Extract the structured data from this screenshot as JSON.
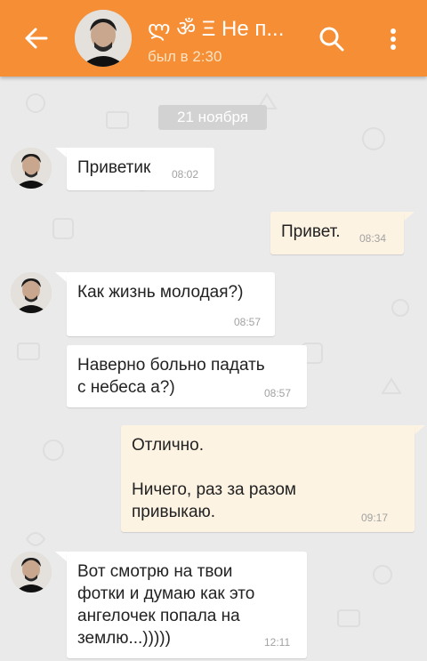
{
  "colors": {
    "header": "#f58e34",
    "incoming_bubble": "#ffffff",
    "outgoing_bubble": "#fdf3e3",
    "background": "#eaeaea"
  },
  "header": {
    "title": "ლ ॐ Ξ Не п...",
    "subtitle": "был в 2:30",
    "back_icon": "arrow-left-icon",
    "search_icon": "search-icon",
    "menu_icon": "more-vertical-icon"
  },
  "date_separator": "21 ноября",
  "messages": [
    {
      "direction": "in",
      "text": "Приветик",
      "time": "08:02"
    },
    {
      "direction": "out",
      "text": "Привет.",
      "time": "08:34"
    },
    {
      "direction": "in",
      "text": "Как жизнь молодая?)",
      "time": "08:57"
    },
    {
      "direction": "in",
      "text": "Наверно больно падать\nс небеса а?)",
      "time": "08:57"
    },
    {
      "direction": "out",
      "text": "Отлично.\n\nНичего, раз за разом\nпривыкаю.",
      "time": "09:17"
    },
    {
      "direction": "in",
      "text": "Вот смотрю на твои\nфотки и думаю как это\nангелочек попала на\nземлю...)))))",
      "time": "12:11"
    }
  ]
}
